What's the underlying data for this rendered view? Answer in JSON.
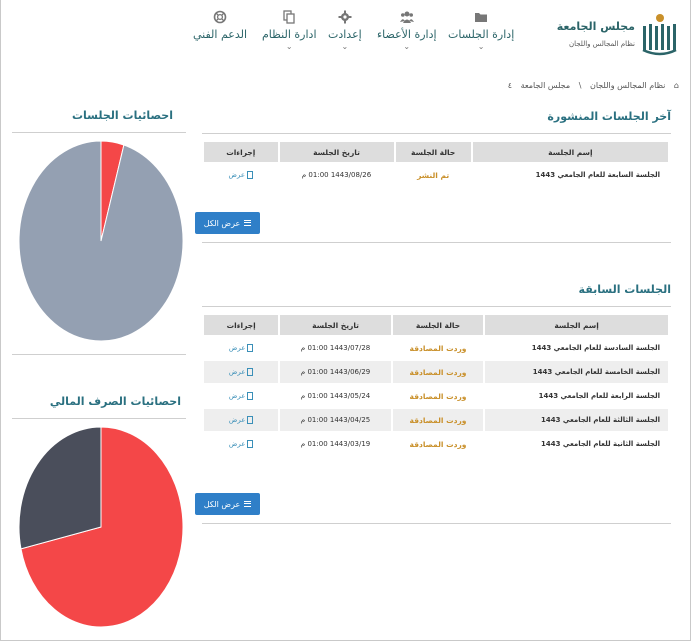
{
  "brand": {
    "title": "مجلس الجامعة",
    "subtitle": "نظام المجالس واللجان"
  },
  "nav": [
    {
      "label": "إدارة الجلسات",
      "icon": "folder-icon"
    },
    {
      "label": "إدارة الأعضاء",
      "icon": "users-icon"
    },
    {
      "label": "إعدادت",
      "icon": "gear-icon"
    },
    {
      "label": "ادارة النظام",
      "icon": "copy-icon"
    },
    {
      "label": "الدعم الفني",
      "icon": "lifebuoy-icon"
    }
  ],
  "breadcrumb": {
    "home_icon": "home-icon",
    "item1": "نظام المجالس واللجان",
    "separator": "\\",
    "item2": "مجلس الجامعة",
    "item3": "٤"
  },
  "published": {
    "title": "آخر الجلسات المنشورة",
    "columns": [
      "إسم الجلسة",
      "حالة الجلسة",
      "تاريخ الجلسة",
      "إجراءات"
    ],
    "rows": [
      {
        "name": "الجلسة السابعة للعام الجامعي 1443",
        "status": "تم النشر",
        "date": "1443/08/26 01:00 م",
        "action": "عرض"
      }
    ],
    "view_all": "عرض الكل"
  },
  "previous": {
    "title": "الجلسات السابقة",
    "columns": [
      "إسم الجلسة",
      "حالة الجلسة",
      "تاريخ الجلسة",
      "إجراءات"
    ],
    "rows": [
      {
        "name": "الجلسة السادسة للعام الجامعي 1443",
        "status": "وردت المصادقة",
        "date": "1443/07/28 01:00 م",
        "action": "عرض"
      },
      {
        "name": "الجلسة الخامسة للعام الجامعي 1443",
        "status": "وردت المصادقة",
        "date": "1443/06/29 01:00 م",
        "action": "عرض"
      },
      {
        "name": "الجلسة الرابعة للعام الجامعي 1443",
        "status": "وردت المصادقة",
        "date": "1443/05/24 01:00 م",
        "action": "عرض"
      },
      {
        "name": "الجلسة الثالثة للعام الجامعي 1443",
        "status": "وردت المصادقة",
        "date": "1443/04/25 01:00 م",
        "action": "عرض"
      },
      {
        "name": "الجلسة الثانية للعام الجامعي 1443",
        "status": "وردت المصادقة",
        "date": "1443/03/19 01:00 م",
        "action": "عرض"
      }
    ],
    "view_all": "عرض الكل"
  },
  "sessions_stats": {
    "title": "احصائيات الجلسات",
    "chart_data": {
      "type": "pie",
      "values": [
        0.045,
        0.955
      ],
      "colors": [
        "#f44748",
        "#94a0b2"
      ]
    }
  },
  "finance_stats": {
    "title": "احصائيات الصرف المالي",
    "chart_data": {
      "type": "pie",
      "values": [
        0.715,
        0.285
      ],
      "colors": [
        "#f44748",
        "#4a4e5b"
      ]
    }
  },
  "colors": {
    "accent": "#2a7080",
    "button": "#2f7fc8",
    "status_gold": "#c9902a"
  }
}
